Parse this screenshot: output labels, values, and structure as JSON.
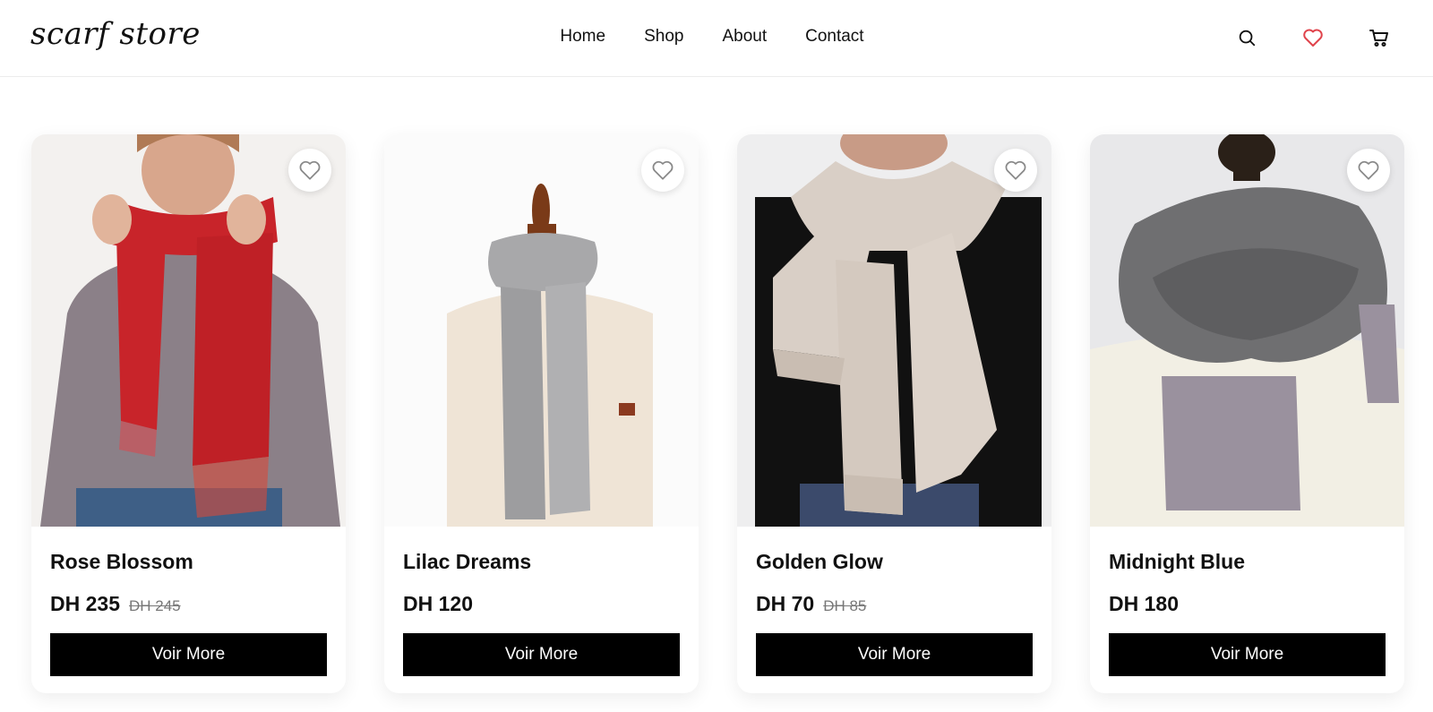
{
  "brand": {
    "logo": "scarf store"
  },
  "nav": {
    "items": [
      {
        "label": "Home"
      },
      {
        "label": "Shop"
      },
      {
        "label": "About"
      },
      {
        "label": "Contact"
      }
    ]
  },
  "header_icons": [
    "search-icon",
    "heart-icon",
    "cart-icon"
  ],
  "colors": {
    "accent": "#e0434b",
    "button": "#000000"
  },
  "products": [
    {
      "name": "Rose Blossom",
      "price": "DH 235",
      "old_price": "DH 245",
      "button": "Voir More",
      "scarf_color": "#c8242a"
    },
    {
      "name": "Lilac Dreams",
      "price": "DH 120",
      "old_price": "",
      "button": "Voir More",
      "scarf_color": "#a8a8aa"
    },
    {
      "name": "Golden Glow",
      "price": "DH 70",
      "old_price": "DH 85",
      "button": "Voir More",
      "scarf_color": "#d9cfc6"
    },
    {
      "name": "Midnight Blue",
      "price": "DH 180",
      "old_price": "",
      "button": "Voir More",
      "scarf_color": "#6f6f71"
    }
  ]
}
